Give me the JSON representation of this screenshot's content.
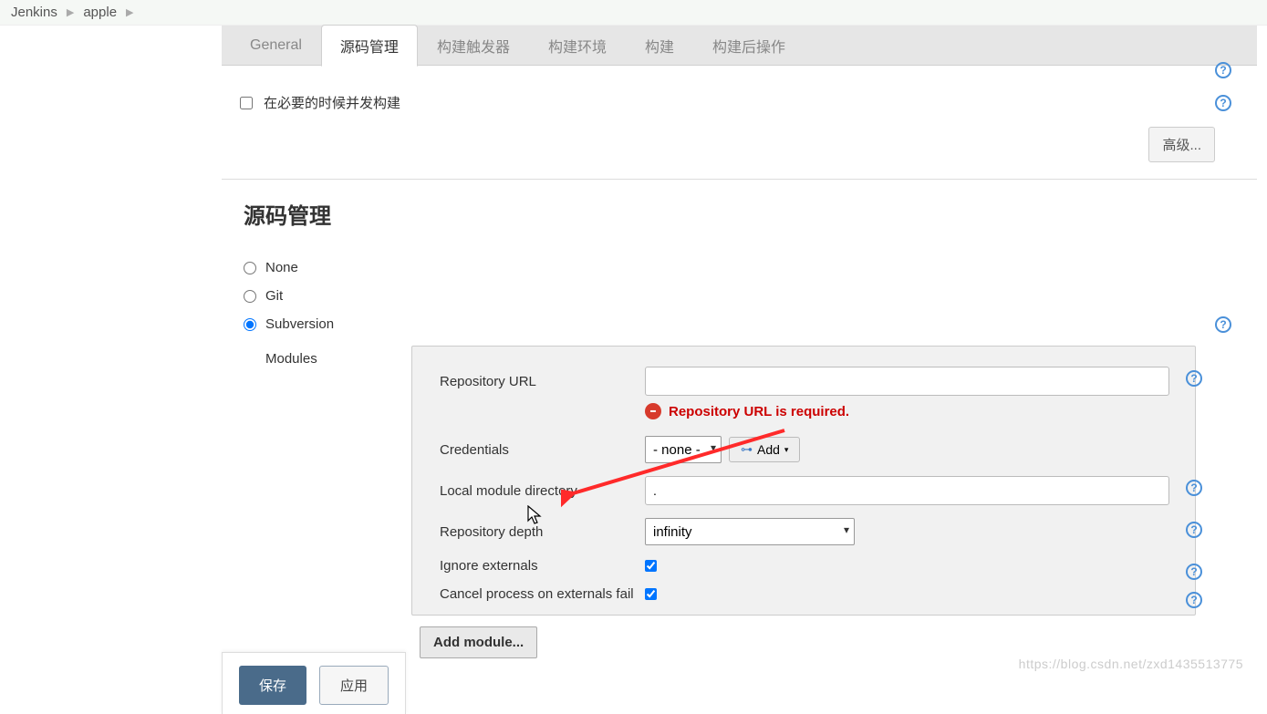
{
  "breadcrumb": {
    "root": "Jenkins",
    "project": "apple"
  },
  "tabs": {
    "general": "General",
    "scm": "源码管理",
    "triggers": "构建触发器",
    "env": "构建环境",
    "build": "构建",
    "post": "构建后操作"
  },
  "topOptions": {
    "concurrentBuild": "在必要的时候并发构建",
    "advanced": "高级..."
  },
  "scm": {
    "title": "源码管理",
    "none": "None",
    "git": "Git",
    "svn": "Subversion",
    "modules": "Modules",
    "fields": {
      "repoUrlLabel": "Repository URL",
      "repoUrlError": "Repository URL is required.",
      "credsLabel": "Credentials",
      "credsNone": "- none -",
      "addBtn": "Add",
      "localDirLabel": "Local module directory",
      "localDirValue": ".",
      "depthLabel": "Repository depth",
      "depthValue": "infinity",
      "ignoreExtLabel": "Ignore externals",
      "cancelExtLabel": "Cancel process on externals fail"
    },
    "addModule": "Add module..."
  },
  "footer": {
    "save": "保存",
    "apply": "应用"
  },
  "watermark": "https://blog.csdn.net/zxd1435513775"
}
